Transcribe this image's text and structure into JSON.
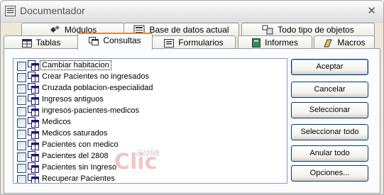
{
  "window": {
    "title": "Documentador",
    "close_glyph": "✕"
  },
  "tabs_back": [
    {
      "label": "Módulos",
      "icon": "modules-icon"
    },
    {
      "label": "Base de datos actual",
      "icon": "database-icon"
    },
    {
      "label": "Todo tipo de objetos",
      "icon": "all-objects-icon"
    }
  ],
  "tabs_front": [
    {
      "label": "Tablas",
      "icon": "table-icon"
    },
    {
      "label": "Consultas",
      "icon": "query-icon",
      "active": true
    },
    {
      "label": "Formularios",
      "icon": "form-icon"
    },
    {
      "label": "Informes",
      "icon": "report-icon"
    },
    {
      "label": "Macros",
      "icon": "macro-icon"
    }
  ],
  "queries": [
    {
      "label": "Cambiar habitacion",
      "selected": true
    },
    {
      "label": "Crear Pacientes no ingresados"
    },
    {
      "label": "Cruzada poblacion-especialidad"
    },
    {
      "label": "Ingresos antiguos"
    },
    {
      "label": "ingresos-pacientes-medicos"
    },
    {
      "label": "Medicos"
    },
    {
      "label": "Medicos saturados"
    },
    {
      "label": "Pacientes con medico"
    },
    {
      "label": "Pacientes del 2808"
    },
    {
      "label": "Pacientes sin Ingreso"
    },
    {
      "label": "Recuperar Pacientes"
    }
  ],
  "buttons": {
    "accept": "Aceptar",
    "cancel": "Cancelar",
    "select": "Seleccionar",
    "select_all": "Seleccionar todo",
    "deselect_all": "Anular todo",
    "options": "Opciones..."
  },
  "scrollbar": {
    "up": "▲",
    "down": "▼"
  },
  "watermark": {
    "brand1": "aula",
    "brand2": "Clic",
    "domain": ".com"
  },
  "colors": {
    "accent_tab": "#e68b2c",
    "border": "#7f9db9",
    "title": "#555555"
  }
}
